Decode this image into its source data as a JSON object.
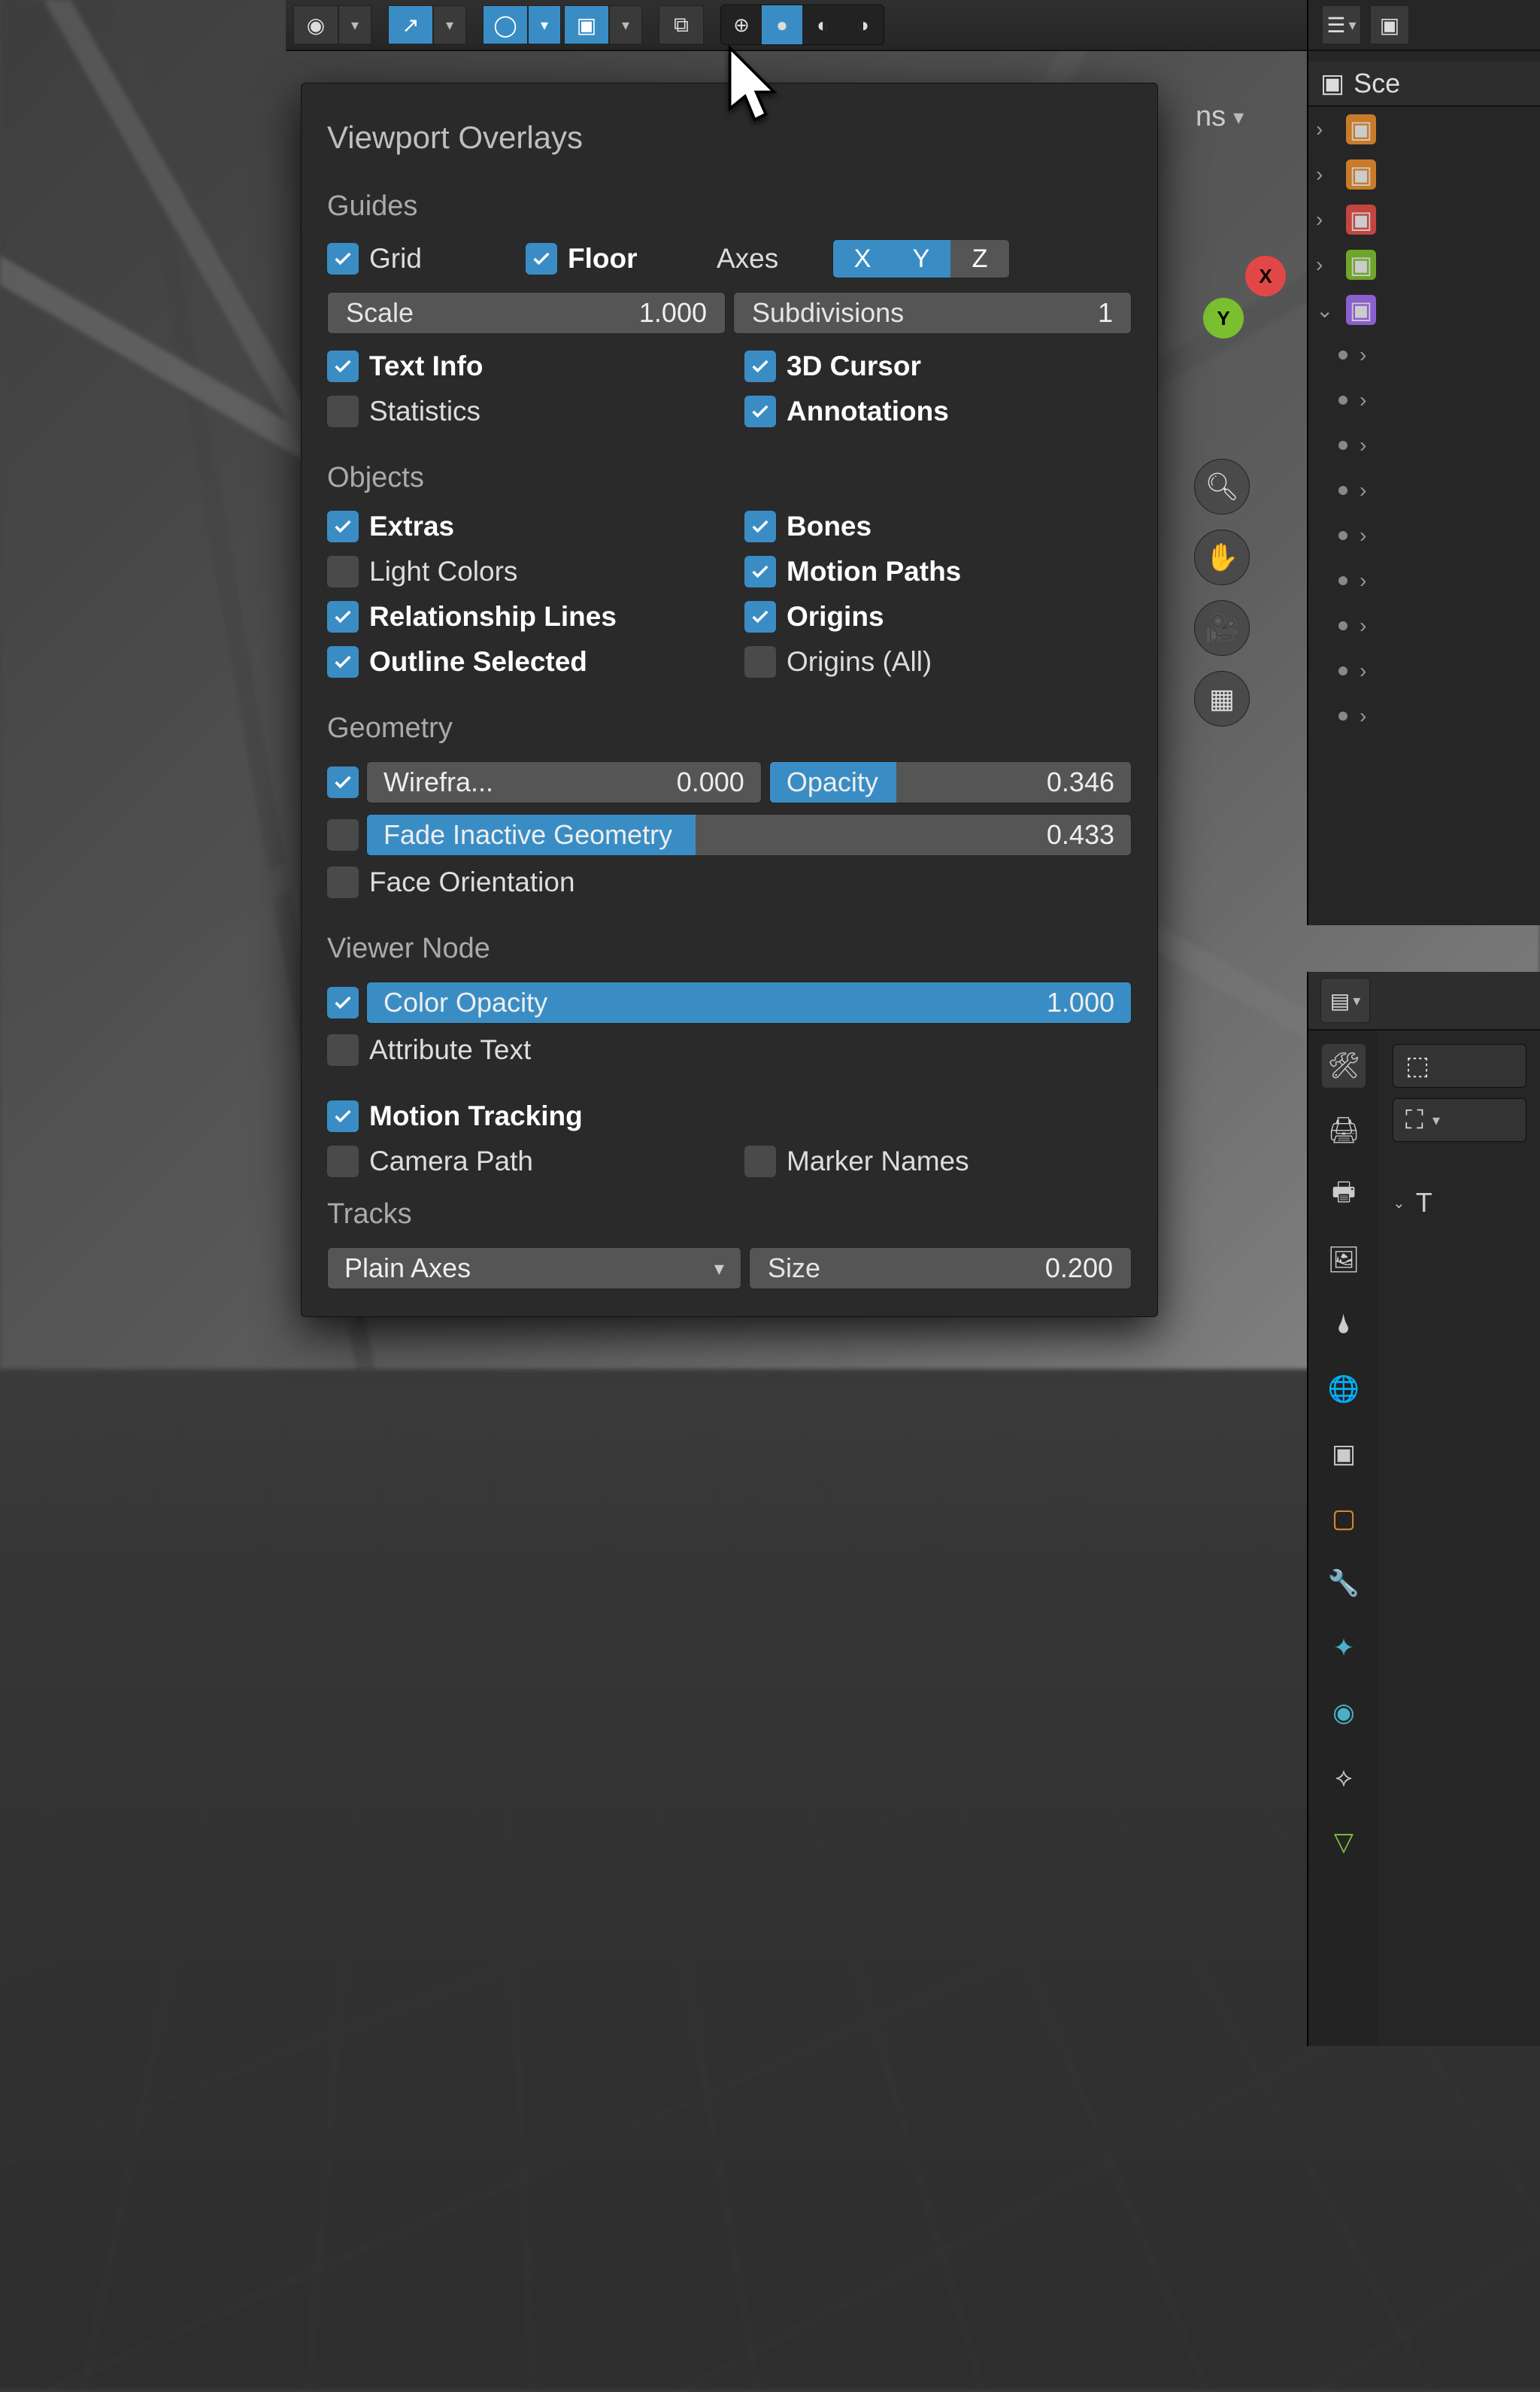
{
  "header": {
    "modes": [
      "wireframe",
      "solid",
      "material",
      "rendered"
    ],
    "active_mode": "solid",
    "options_label": "ns"
  },
  "gizmo": {
    "x": "X",
    "y": "Y"
  },
  "nav_buttons": [
    "zoom",
    "pan",
    "camera",
    "grid"
  ],
  "popover": {
    "title": "Viewport Overlays",
    "guides": {
      "label": "Guides",
      "grid": {
        "label": "Grid",
        "checked": true
      },
      "floor": {
        "label": "Floor",
        "checked": true
      },
      "axes_label": "Axes",
      "axes": {
        "x": "X",
        "y": "Y",
        "z": "Z",
        "x_on": true,
        "y_on": true,
        "z_on": false
      },
      "scale": {
        "label": "Scale",
        "value": "1.000"
      },
      "subdiv": {
        "label": "Subdivisions",
        "value": "1"
      },
      "textinfo": {
        "label": "Text Info",
        "checked": true
      },
      "statistics": {
        "label": "Statistics",
        "checked": false
      },
      "cursor3d": {
        "label": "3D Cursor",
        "checked": true
      },
      "annotations": {
        "label": "Annotations",
        "checked": true
      }
    },
    "objects": {
      "label": "Objects",
      "extras": {
        "label": "Extras",
        "checked": true
      },
      "lightcolors": {
        "label": "Light Colors",
        "checked": false
      },
      "rel": {
        "label": "Relationship Lines",
        "checked": true
      },
      "outline": {
        "label": "Outline Selected",
        "checked": true
      },
      "bones": {
        "label": "Bones",
        "checked": true
      },
      "motion": {
        "label": "Motion Paths",
        "checked": true
      },
      "origins": {
        "label": "Origins",
        "checked": true
      },
      "origins_all": {
        "label": "Origins (All)",
        "checked": false
      }
    },
    "geometry": {
      "label": "Geometry",
      "wire": {
        "label": "Wirefra...",
        "value": "0.000",
        "checked": true,
        "fillpct": 0
      },
      "opacity": {
        "label": "Opacity",
        "value": "0.346",
        "fillpct": 35
      },
      "fade": {
        "label": "Fade Inactive Geometry",
        "value": "0.433",
        "checked": false,
        "fillpct": 43
      },
      "face": {
        "label": "Face Orientation",
        "checked": false
      }
    },
    "viewer": {
      "label": "Viewer Node",
      "color": {
        "label": "Color Opacity",
        "value": "1.000",
        "checked": true,
        "fillpct": 100
      },
      "attr": {
        "label": "Attribute Text",
        "checked": false
      }
    },
    "tracking": {
      "motion": {
        "label": "Motion Tracking",
        "checked": true
      },
      "camera": {
        "label": "Camera Path",
        "checked": false
      },
      "markers": {
        "label": "Marker Names",
        "checked": false
      },
      "tracks_label": "Tracks",
      "tracks_value": "Plain Axes",
      "size": {
        "label": "Size",
        "value": "0.200"
      }
    }
  },
  "outliner": {
    "header": "Sce",
    "rows": [
      {
        "type": "coll",
        "color": "orange",
        "expand": true
      },
      {
        "type": "coll",
        "color": "orange",
        "expand": true
      },
      {
        "type": "coll",
        "color": "red",
        "expand": true
      },
      {
        "type": "coll",
        "color": "green",
        "expand": true
      },
      {
        "type": "coll",
        "color": "purple",
        "expand": false
      }
    ],
    "items_count": 8
  },
  "props": {
    "collapse_label": "T"
  }
}
